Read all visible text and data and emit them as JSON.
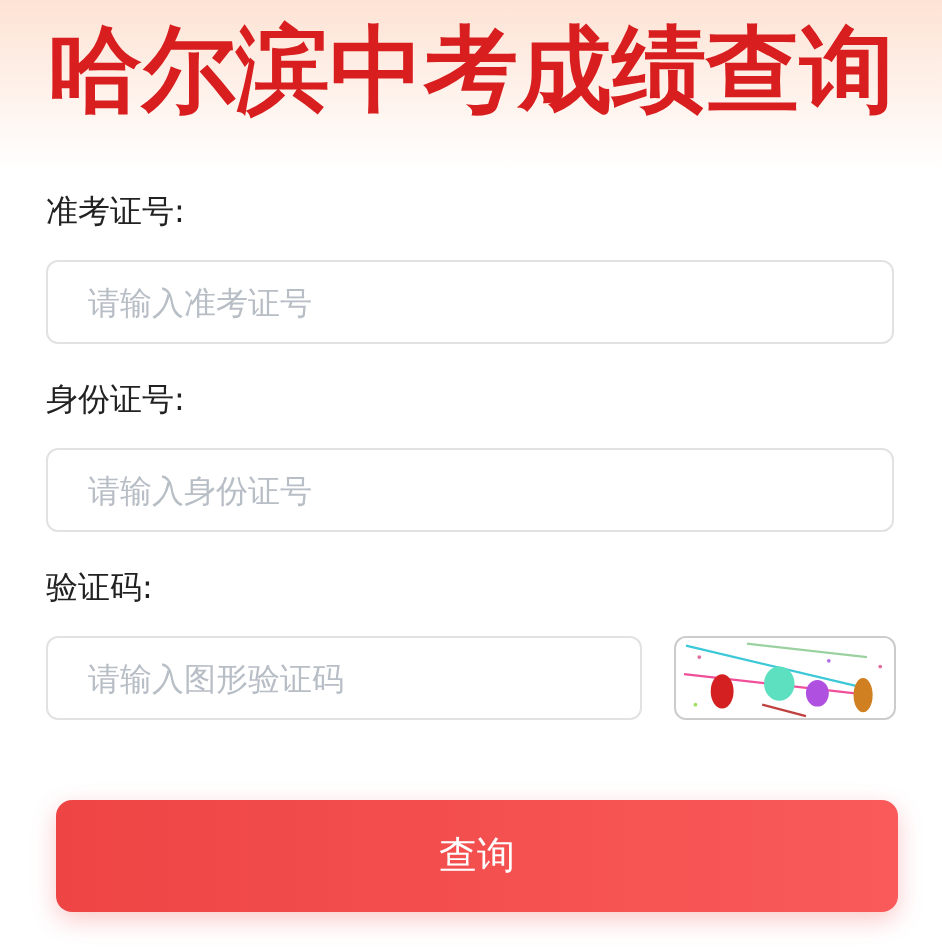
{
  "title": "哈尔滨中考成绩查询",
  "fields": [
    {
      "label": "准考证号:",
      "placeholder": "请输入准考证号",
      "kind": "text"
    },
    {
      "label": "身份证号:",
      "placeholder": "请输入身份证号",
      "kind": "text"
    },
    {
      "label": "验证码:",
      "placeholder": "请输入图形验证码",
      "kind": "captcha"
    }
  ],
  "submit_button": "查询"
}
